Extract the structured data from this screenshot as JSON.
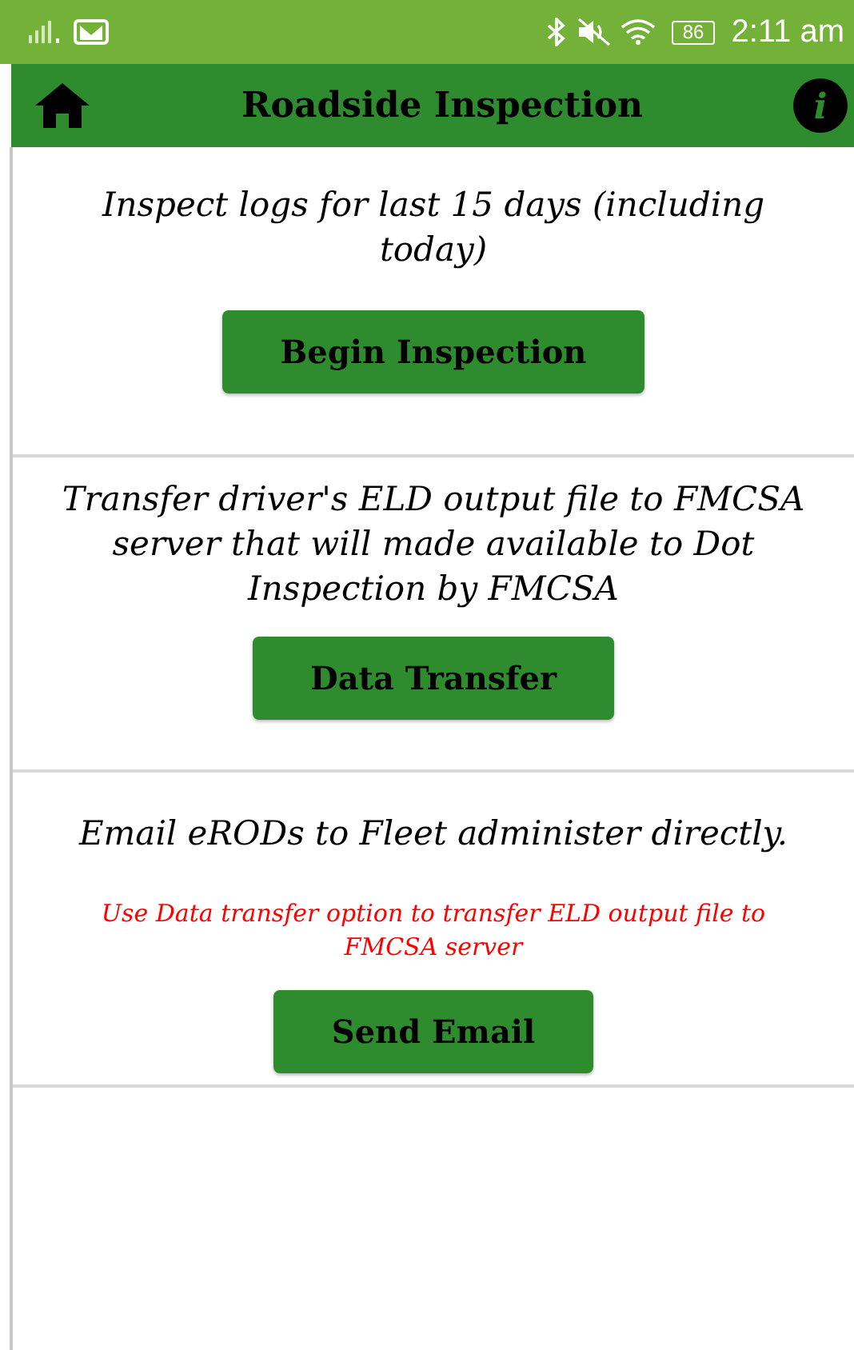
{
  "status_bar": {
    "battery": "86",
    "time": "2:11 am"
  },
  "header": {
    "title": "Roadside Inspection",
    "info": "i"
  },
  "sections": [
    {
      "description": "Inspect logs for last 15 days (including today)",
      "button": "Begin Inspection"
    },
    {
      "description": "Transfer driver's ELD output file to FMCSA server that will made available to Dot Inspection by FMCSA",
      "button": "Data Transfer"
    },
    {
      "description": "Email eRODs to Fleet administer directly.",
      "note": "Use Data transfer option to transfer ELD output file to FMCSA server",
      "button": "Send Email"
    }
  ]
}
